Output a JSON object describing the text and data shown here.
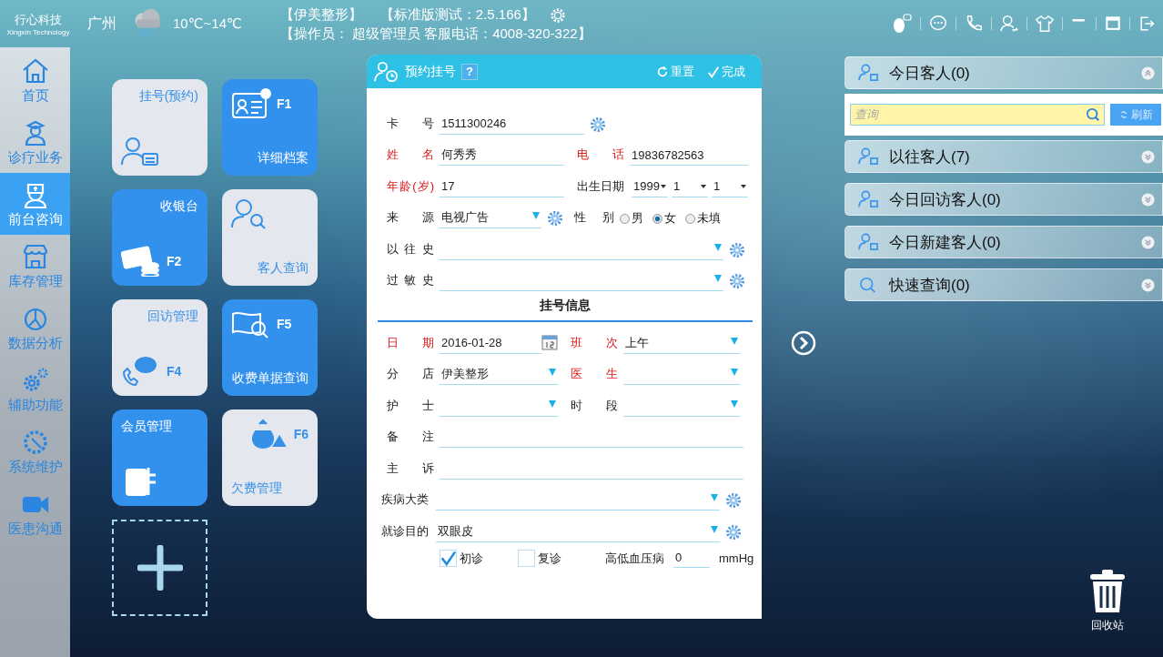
{
  "header": {
    "logo": "行心科技",
    "logo_sub": "Xingxin Technology",
    "city": "广州",
    "temperature": "10℃~14℃",
    "clinic": "【伊美整形】",
    "version": "【标准版测试：2.5.166】",
    "operator": "【操作员： 超级管理员  客服电话：4008-320-322】"
  },
  "sidebar": {
    "items": [
      {
        "label": "首页",
        "selected": false
      },
      {
        "label": "诊疗业务",
        "selected": false
      },
      {
        "label": "前台咨询",
        "selected": true
      },
      {
        "label": "库存管理",
        "selected": false
      },
      {
        "label": "数据分析",
        "selected": false
      },
      {
        "label": "辅助功能",
        "selected": false
      },
      {
        "label": "系统维护",
        "selected": false
      },
      {
        "label": "医患沟通",
        "selected": false
      }
    ]
  },
  "tiles": [
    {
      "label": "挂号(预约)",
      "kind": "light"
    },
    {
      "label": "详细档案",
      "key": "F1",
      "kind": "blue"
    },
    {
      "label": "收银台",
      "key": "F2",
      "kind": "blue"
    },
    {
      "label": "客人查询",
      "kind": "light"
    },
    {
      "label": "回访管理",
      "key": "F4",
      "kind": "light"
    },
    {
      "label": "收费单据查询",
      "key": "F5",
      "kind": "blue"
    },
    {
      "label": "会员管理",
      "kind": "blue"
    },
    {
      "label": "欠费管理",
      "key": "F6",
      "kind": "light"
    }
  ],
  "form": {
    "title": "预约挂号",
    "help": "?",
    "actions": [
      {
        "label": "重置",
        "kind": "reset"
      },
      {
        "label": "完成",
        "kind": "done"
      }
    ],
    "card_no": {
      "label": "卡 号",
      "value": "1511300246",
      "required": false
    },
    "name": {
      "label": "姓 名",
      "value": "何秀秀",
      "required": true
    },
    "phone": {
      "label": "电 话",
      "value": "19836782563",
      "required": true
    },
    "age": {
      "label": "年龄(岁)",
      "value": "17",
      "required": true
    },
    "birth": {
      "label": "出生日期",
      "year": "1999",
      "month": "1",
      "day": "1",
      "required": false
    },
    "source": {
      "label": "来 源",
      "value": "电视广告",
      "required": false
    },
    "gender": {
      "label": "性 别",
      "required": false,
      "options": [
        {
          "label": "男",
          "selected": false
        },
        {
          "label": "女",
          "selected": true
        },
        {
          "label": "未填",
          "selected": false
        }
      ]
    },
    "history": {
      "label": "以 往 史",
      "required": false
    },
    "allergy": {
      "label": "过 敏 史",
      "required": false
    },
    "section_title": "挂号信息",
    "date": {
      "label": "日 期",
      "value": "2016-01-28",
      "required": true
    },
    "shift": {
      "label": "班 次",
      "value": "上午",
      "required": true
    },
    "branch": {
      "label": "分 店",
      "value": "伊美整形",
      "required": false
    },
    "doctor": {
      "label": "医 生",
      "required": true
    },
    "nurse": {
      "label": "护 士",
      "required": false
    },
    "period": {
      "label": "时 段",
      "required": false
    },
    "remark": {
      "label": "备 注",
      "required": false
    },
    "complaint": {
      "label": "主 诉",
      "required": false
    },
    "disease_category": {
      "label": "疾病大类",
      "required": false
    },
    "purpose": {
      "label": "就诊目的",
      "value": "双眼皮",
      "required": false
    },
    "visit_types": [
      {
        "label": "初诊",
        "checked": true
      },
      {
        "label": "复诊",
        "checked": false
      }
    ],
    "blood_pressure": {
      "label": "高低血压病",
      "value": "0",
      "unit": "mmHg"
    }
  },
  "right_panel": {
    "sections": [
      {
        "label": "今日客人(0)",
        "expanded": true
      },
      {
        "label": "以往客人(7)",
        "expanded": false
      },
      {
        "label": "今日回访客人(0)",
        "expanded": false
      },
      {
        "label": "今日新建客人(0)",
        "expanded": false
      },
      {
        "label": "快速查询(0)",
        "expanded": false
      }
    ],
    "search": {
      "placeholder": "查询",
      "button": "刷新"
    }
  },
  "trash": {
    "label": "回收站"
  }
}
